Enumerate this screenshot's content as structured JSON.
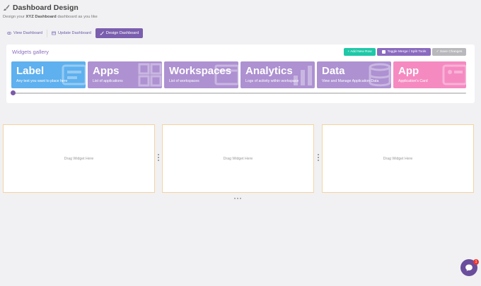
{
  "header": {
    "title": "Dashboard Design",
    "subtitle_pre": "Design your ",
    "subtitle_bold": "XYZ Dashboard",
    "subtitle_post": " dashboard as you like"
  },
  "tabs": [
    {
      "label": "View Dashboard",
      "icon": "eye-icon"
    },
    {
      "label": "Update Dashboard",
      "icon": "window-icon"
    },
    {
      "label": "Design Dashboard",
      "icon": "brush-icon"
    }
  ],
  "gallery": {
    "title": "Widgets gallery",
    "add_row_label": "+ Add New Row",
    "toggle_label": "Toggle Merge / Split Tools",
    "save_label": "✓ Save Changes",
    "slider_position": 0
  },
  "widgets": [
    {
      "title": "Label",
      "desc": "Any text you want to place here",
      "icon": "label-icon"
    },
    {
      "title": "Apps",
      "desc": "List of applications",
      "icon": "apps-grid-icon"
    },
    {
      "title": "Workspaces",
      "desc": "List of workspaces",
      "icon": "workspaces-icon"
    },
    {
      "title": "Analytics",
      "desc": "Logs of activity within workspace",
      "icon": "analytics-icon"
    },
    {
      "title": "Data",
      "desc": "View and Manage Application Data",
      "icon": "database-icon"
    },
    {
      "title": "App",
      "desc": "Application's Card",
      "icon": "app-card-icon"
    }
  ],
  "drop_zones": [
    {
      "label": "Drag Widget Here"
    },
    {
      "label": "Drag Widget Here"
    },
    {
      "label": "Drag Widget Here"
    }
  ],
  "chat": {
    "badge": "1",
    "icon": "chat-icon"
  },
  "colors": {
    "accent": "#7b5fae",
    "teal": "#1fc8a8",
    "blue_widget": "#5eb0ee",
    "purple_widget": "#ad91d1",
    "pink_widget": "#f58ac1",
    "drop_border": "#f5d3a0"
  }
}
